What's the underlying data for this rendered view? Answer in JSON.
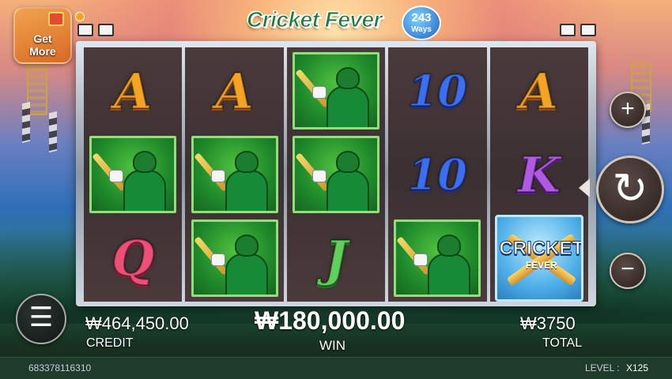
{
  "title": {
    "main": "Cricket Fever",
    "ways_number": "243",
    "ways_label": "Ways"
  },
  "get_more": {
    "label_line1": "Get",
    "label_line2": "More"
  },
  "reels": [
    [
      "A",
      "player",
      "Q"
    ],
    [
      "A",
      "player",
      "player"
    ],
    [
      "player",
      "player",
      "J"
    ],
    [
      "10",
      "10",
      "player"
    ],
    [
      "A",
      "K",
      "logo"
    ]
  ],
  "logo_symbol": {
    "line1": "CRICKET",
    "line2": "FEVER"
  },
  "controls": {
    "plus": "+",
    "minus": "−",
    "spin": "↻",
    "menu": "☰"
  },
  "stats": {
    "credit_value": "₩464,450.00",
    "credit_label": "CREDIT",
    "win_value": "₩180,000.00",
    "win_label": "WIN",
    "total_value": "₩3750",
    "total_label": "TOTAL"
  },
  "footer": {
    "id": "683378116310",
    "level_label": "LEVEL :",
    "level_value": "X125"
  }
}
